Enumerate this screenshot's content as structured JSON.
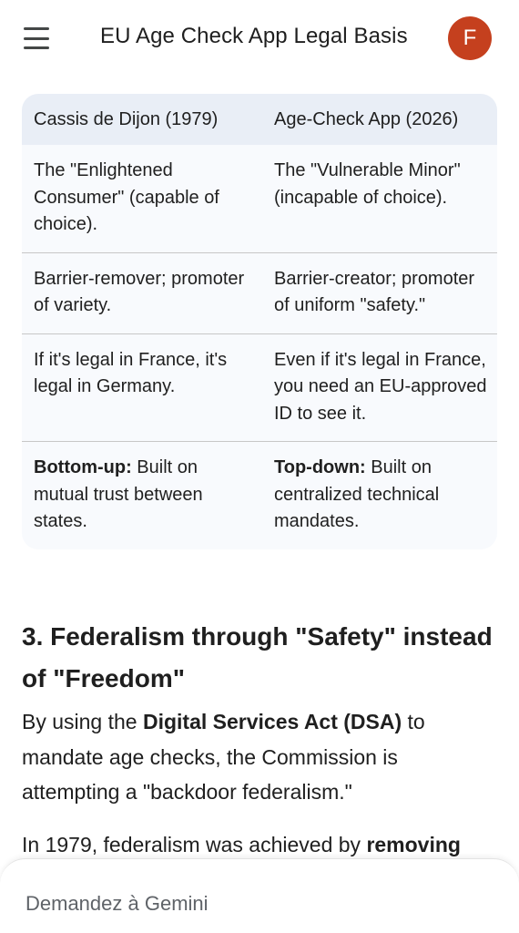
{
  "header": {
    "title": "EU Age Check App Legal Basis",
    "avatar_letter": "F",
    "avatar_color": "#c5401e"
  },
  "table": {
    "headers": [
      "Cassis de Dijon (1979)",
      "Age-Check App (2026)"
    ],
    "rows": [
      {
        "c1": {
          "bold": "",
          "text": "The \"Enlightened Consumer\" (capable of choice)."
        },
        "c2": {
          "bold": "",
          "text": "The \"Vulnerable Minor\" (incapable of choice)."
        }
      },
      {
        "c1": {
          "bold": "",
          "text": "Barrier-remover; promoter of variety."
        },
        "c2": {
          "bold": "",
          "text": "Barrier-creator; promoter of uniform \"safety.\""
        }
      },
      {
        "c1": {
          "bold": "",
          "text": "If it's legal in France, it's legal in Germany."
        },
        "c2": {
          "bold": "",
          "text": "Even if it's legal in France, you need an EU-approved ID to see it."
        }
      },
      {
        "c1": {
          "bold": "Bottom-up:",
          "text": " Built on mutual trust between states."
        },
        "c2": {
          "bold": "Top-down:",
          "text": " Built on centralized technical mandates."
        }
      }
    ]
  },
  "section": {
    "heading": "3. Federalism through \"Safety\" instead of \"Freedom\"",
    "p1_before": "By using the ",
    "p1_bold": "Digital Services Act (DSA)",
    "p1_after": " to mandate age checks, the Commission is attempting a \"backdoor federalism.\"",
    "p2_before": "In 1979, federalism was achieved by ",
    "p2_bold": "removing"
  },
  "input": {
    "placeholder": "Demandez à Gemini"
  }
}
